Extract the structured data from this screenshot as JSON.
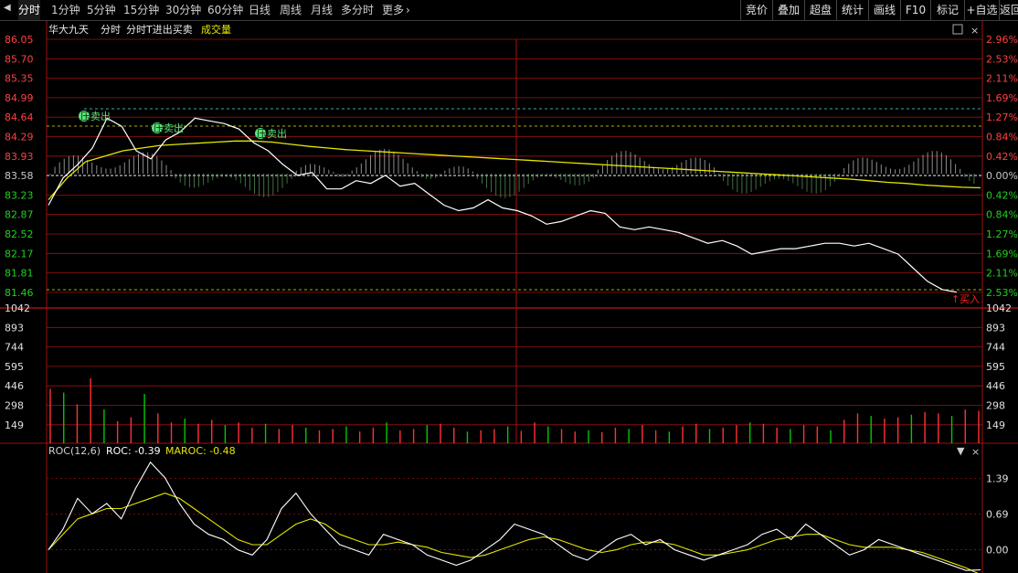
{
  "toolbar": {
    "nav_icon": "triangle-left-icon",
    "tabs": [
      "分时",
      "1分钟",
      "5分钟",
      "15分钟",
      "30分钟",
      "60分钟",
      "日线",
      "周线",
      "月线",
      "多分时",
      "更多"
    ],
    "active_tab": "分时",
    "more_icon": "chevron-right-icon",
    "right_buttons": [
      "竞价",
      "叠加",
      "超盘",
      "统计",
      "画线",
      "F10",
      "标记",
      "+自选",
      "返回"
    ]
  },
  "header": {
    "stock_name": "华大九天",
    "mode": "分时",
    "strategy": "分时T进出买卖",
    "volume_label": "成交量",
    "collapse_icon": "collapse-icon",
    "close_icon": "close-icon"
  },
  "price_axis": {
    "left": [
      "86.05",
      "85.70",
      "85.35",
      "84.99",
      "84.64",
      "84.29",
      "83.93",
      "83.58",
      "83.23",
      "82.87",
      "82.52",
      "82.17",
      "81.81",
      "81.46"
    ],
    "right": [
      "2.96%",
      "2.53%",
      "2.11%",
      "1.69%",
      "1.27%",
      "0.84%",
      "0.42%",
      "0.00%",
      "0.42%",
      "0.84%",
      "1.27%",
      "1.69%",
      "2.11%",
      "2.53%"
    ],
    "prev_close": "83.58"
  },
  "volume_axis": {
    "labels": [
      "1042",
      "893",
      "744",
      "595",
      "446",
      "298",
      "149"
    ]
  },
  "roc_panel": {
    "title": "ROC(12,6)",
    "roc_label": "ROC: -0.39",
    "maroc_label": "MAROC: -0.48",
    "axis": [
      "1.39",
      "0.69",
      "0.00"
    ],
    "dropdown_icon": "dropdown-icon",
    "close_icon": "close-icon"
  },
  "signals": [
    {
      "label": "卖出",
      "badge": "压"
    },
    {
      "label": "卖出",
      "badge": "压"
    },
    {
      "label": "卖出",
      "badge": "压"
    },
    {
      "label": "买入",
      "badge": ""
    }
  ],
  "colors": {
    "up": "#ff3232",
    "down": "#00c800",
    "price_line": "#ffffff",
    "avg_line": "#e6e600",
    "grid": "#a01010",
    "signal": "#5be07a",
    "axis_text_up": "#ff4040",
    "axis_text_down": "#20d020",
    "prev_close": "#c8c8c8"
  },
  "chart_data": {
    "type": "line",
    "price": [
      83.0,
      83.5,
      83.75,
      84.05,
      84.6,
      84.45,
      84.0,
      83.85,
      84.2,
      84.35,
      84.6,
      84.55,
      84.5,
      84.4,
      84.15,
      84.0,
      83.75,
      83.55,
      83.6,
      83.3,
      83.3,
      83.45,
      83.4,
      83.55,
      83.35,
      83.4,
      83.2,
      83.0,
      82.9,
      82.95,
      83.1,
      82.95,
      82.9,
      82.8,
      82.65,
      82.7,
      82.8,
      82.9,
      82.85,
      82.6,
      82.55,
      82.6,
      82.55,
      82.5,
      82.4,
      82.3,
      82.35,
      82.25,
      82.1,
      82.15,
      82.2,
      82.2,
      82.25,
      82.3,
      82.3,
      82.25,
      82.3,
      82.2,
      82.1,
      81.85,
      81.6,
      81.45,
      81.4
    ],
    "avg_price": [
      83.1,
      83.5,
      83.8,
      83.9,
      84.0,
      84.05,
      84.1,
      84.12,
      84.14,
      84.16,
      84.18,
      84.18,
      84.16,
      84.12,
      84.08,
      84.05,
      84.02,
      84.0,
      83.98,
      83.96,
      83.94,
      83.92,
      83.9,
      83.88,
      83.86,
      83.84,
      83.82,
      83.8,
      83.78,
      83.76,
      83.74,
      83.72,
      83.7,
      83.68,
      83.66,
      83.64,
      83.62,
      83.6,
      83.58,
      83.56,
      83.54,
      83.52,
      83.5,
      83.48,
      83.45,
      83.42,
      83.4,
      83.37,
      83.35,
      83.33,
      83.32
    ],
    "volume": [
      420,
      390,
      300,
      500,
      260,
      170,
      200,
      380,
      230,
      160,
      190,
      150,
      180,
      140,
      160,
      120,
      150,
      110,
      140,
      120,
      100,
      110,
      130,
      90,
      120,
      160,
      100,
      110,
      140,
      150,
      120,
      90,
      100,
      110,
      130,
      95,
      160,
      130,
      110,
      90,
      100,
      85,
      120,
      110,
      140,
      100,
      90,
      130,
      150,
      110,
      120,
      140,
      160,
      150,
      120,
      110,
      140,
      130,
      100,
      180,
      230,
      210,
      190,
      200,
      220,
      240,
      230,
      210,
      260,
      250
    ],
    "roc": [
      0.0,
      0.4,
      1.0,
      0.7,
      0.9,
      0.6,
      1.2,
      1.7,
      1.4,
      0.9,
      0.5,
      0.3,
      0.2,
      0.0,
      -0.1,
      0.2,
      0.8,
      1.1,
      0.7,
      0.4,
      0.1,
      0.0,
      -0.1,
      0.3,
      0.2,
      0.1,
      -0.1,
      -0.2,
      -0.3,
      -0.2,
      0.0,
      0.2,
      0.5,
      0.4,
      0.3,
      0.1,
      -0.1,
      -0.2,
      0.0,
      0.2,
      0.3,
      0.1,
      0.2,
      0.0,
      -0.1,
      -0.2,
      -0.1,
      0.0,
      0.1,
      0.3,
      0.4,
      0.2,
      0.5,
      0.3,
      0.1,
      -0.1,
      0.0,
      0.2,
      0.1,
      0.0,
      -0.1,
      -0.2,
      -0.3,
      -0.4,
      -0.39
    ],
    "maroc": [
      0.0,
      0.3,
      0.6,
      0.7,
      0.8,
      0.8,
      0.9,
      1.0,
      1.1,
      1.0,
      0.8,
      0.6,
      0.4,
      0.2,
      0.1,
      0.1,
      0.3,
      0.5,
      0.6,
      0.5,
      0.3,
      0.2,
      0.1,
      0.1,
      0.15,
      0.1,
      0.05,
      -0.05,
      -0.1,
      -0.15,
      -0.1,
      0.0,
      0.1,
      0.2,
      0.25,
      0.2,
      0.1,
      0.0,
      -0.05,
      0.0,
      0.1,
      0.15,
      0.15,
      0.1,
      0.0,
      -0.1,
      -0.1,
      -0.05,
      0.0,
      0.1,
      0.2,
      0.25,
      0.3,
      0.3,
      0.2,
      0.1,
      0.05,
      0.05,
      0.05,
      0.0,
      -0.05,
      -0.15,
      -0.25,
      -0.35,
      -0.48
    ],
    "price_range": [
      81.11,
      86.05
    ],
    "volume_range": [
      0,
      1042
    ],
    "roc_range": [
      -0.45,
      1.75
    ],
    "prev_close": 83.58
  }
}
